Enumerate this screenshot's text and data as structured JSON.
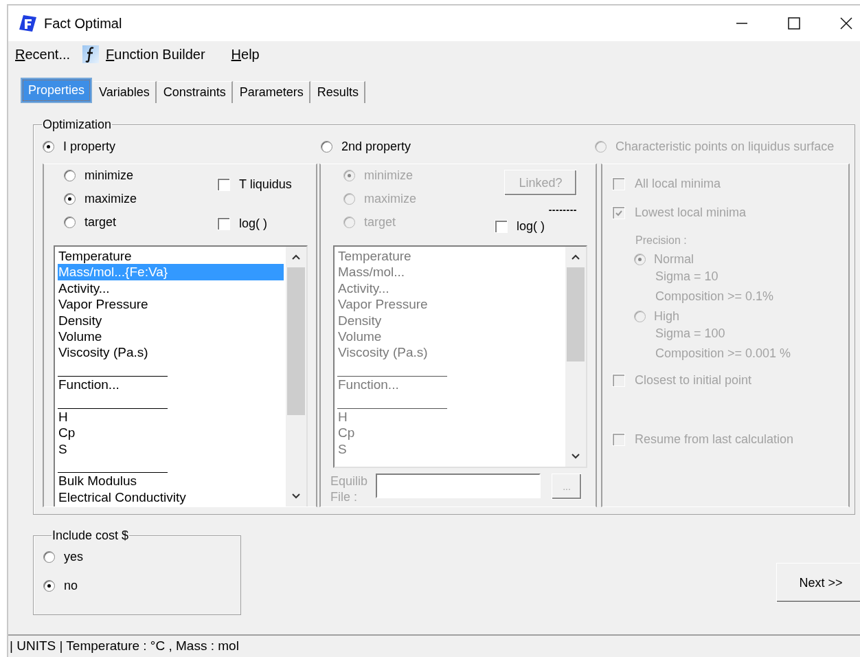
{
  "window": {
    "title": "Fact Optimal"
  },
  "menu": [
    {
      "label": "Recent...",
      "kind": "plain"
    },
    {
      "label": "Function Builder",
      "kind": "with-icon"
    },
    {
      "label": "Help",
      "kind": "plain"
    }
  ],
  "tabs": [
    {
      "label": "Properties",
      "selected": true
    },
    {
      "label": "Variables",
      "selected": false
    },
    {
      "label": "Constraints",
      "selected": false
    },
    {
      "label": "Parameters",
      "selected": false
    },
    {
      "label": "Results",
      "selected": false
    }
  ],
  "optimization": {
    "title": "Optimization",
    "modes": [
      {
        "label": "I property",
        "selected": true,
        "disabled": false
      },
      {
        "label": "2nd property",
        "selected": false,
        "disabled": false
      },
      {
        "label": "Characteristic points on liquidus surface",
        "selected": false,
        "disabled": true
      }
    ],
    "property1": {
      "disabled": false,
      "goals": [
        {
          "label": "minimize",
          "selected": false
        },
        {
          "label": "maximize",
          "selected": true
        },
        {
          "label": "target",
          "selected": false
        }
      ],
      "checkboxes": [
        {
          "label": "T liquidus",
          "checked": false,
          "disabled": false
        },
        {
          "label": "log( )",
          "checked": false,
          "disabled": false
        }
      ],
      "list": [
        {
          "kind": "item",
          "label": "Temperature",
          "selected": false
        },
        {
          "kind": "item",
          "label": "Mass/mol...{Fe:Va}",
          "selected": true
        },
        {
          "kind": "item",
          "label": "Activity...",
          "selected": false
        },
        {
          "kind": "item",
          "label": "Vapor Pressure",
          "selected": false
        },
        {
          "kind": "item",
          "label": "Density",
          "selected": false
        },
        {
          "kind": "item",
          "label": "Volume",
          "selected": false
        },
        {
          "kind": "item",
          "label": "Viscosity (Pa.s)",
          "selected": false
        },
        {
          "kind": "separator"
        },
        {
          "kind": "item",
          "label": "Function...",
          "selected": false
        },
        {
          "kind": "separator"
        },
        {
          "kind": "item",
          "label": "H",
          "selected": false
        },
        {
          "kind": "item",
          "label": "Cp",
          "selected": false
        },
        {
          "kind": "item",
          "label": "S",
          "selected": false
        },
        {
          "kind": "separator"
        },
        {
          "kind": "item",
          "label": "Bulk Modulus",
          "selected": false
        },
        {
          "kind": "item",
          "label": "Electrical Conductivity",
          "selected": false
        }
      ]
    },
    "property2": {
      "disabled": true,
      "goals": [
        {
          "label": "minimize",
          "selected": true
        },
        {
          "label": "maximize",
          "selected": false
        },
        {
          "label": "target",
          "selected": false
        }
      ],
      "linked_button": "Linked?",
      "dashes": "--------",
      "checkboxes": [
        {
          "label": "log( )",
          "checked": false,
          "disabled": false
        }
      ],
      "list": [
        {
          "kind": "item",
          "label": "Temperature",
          "selected": false
        },
        {
          "kind": "item",
          "label": "Mass/mol...",
          "selected": false
        },
        {
          "kind": "item",
          "label": "Activity...",
          "selected": false
        },
        {
          "kind": "item",
          "label": "Vapor Pressure",
          "selected": false
        },
        {
          "kind": "item",
          "label": "Density",
          "selected": false
        },
        {
          "kind": "item",
          "label": "Volume",
          "selected": false
        },
        {
          "kind": "item",
          "label": "Viscosity (Pa.s)",
          "selected": false
        },
        {
          "kind": "separator"
        },
        {
          "kind": "item",
          "label": "Function...",
          "selected": false
        },
        {
          "kind": "separator"
        },
        {
          "kind": "item",
          "label": "H",
          "selected": false
        },
        {
          "kind": "item",
          "label": "Cp",
          "selected": false
        },
        {
          "kind": "item",
          "label": "S",
          "selected": false
        }
      ],
      "equilib_label": "Equilib File :",
      "browse_button": "..."
    },
    "characteristic": {
      "disabled": true,
      "all_local_minima": {
        "label": "All local minima",
        "checked": false
      },
      "lowest_local_minima": {
        "label": "Lowest local minima",
        "checked": true
      },
      "precision_label": "Precision :",
      "precision": [
        {
          "label": "Normal",
          "selected": true,
          "details": [
            "Sigma = 10",
            "Composition >= 0.1%"
          ]
        },
        {
          "label": "High",
          "selected": false,
          "details": [
            "Sigma = 100",
            "Composition >= 0.001 %"
          ]
        }
      ],
      "closest": {
        "label": "Closest to initial point",
        "checked": false
      },
      "resume": {
        "label": "Resume from last calculation",
        "checked": false
      }
    }
  },
  "include_cost": {
    "title": "Include cost $",
    "options": [
      {
        "label": "yes",
        "selected": false
      },
      {
        "label": "no",
        "selected": true
      }
    ]
  },
  "next_button": "Next >>",
  "status_bar": "| UNITS | Temperature : °C , Mass : mol"
}
